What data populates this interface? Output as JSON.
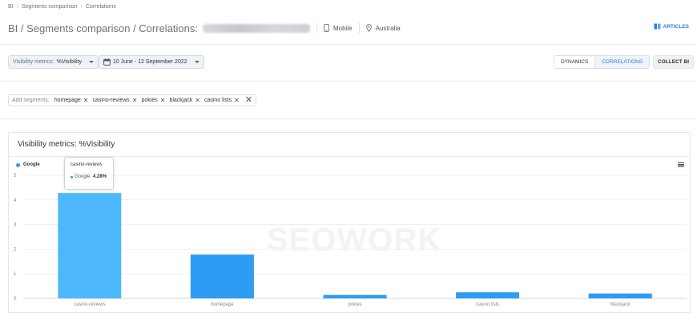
{
  "breadcrumb": [
    "BI",
    "Segments comparison",
    "Correlations"
  ],
  "title": "BI / Segments comparison / Correlations:",
  "device": "Mobile",
  "region": "Australia",
  "articles_label": "ARTICLES",
  "controls": {
    "metric_label": "Visibility metrics:",
    "metric_value": "%Visibility",
    "date_range": "10 June - 12 September 2022",
    "dynamics_label": "DYNAMICS",
    "correlations_label": "CORRELATIONS",
    "collect_label": "COLLECT BI"
  },
  "segments": {
    "label": "Add segments:",
    "items": [
      "homepage",
      "casino-reviews",
      "pokies",
      "blackjack",
      "casino lists"
    ]
  },
  "chart_card": {
    "title": "Visibility metrics: %Visibility",
    "watermark": "SEOWORK"
  },
  "tooltip": {
    "category": "casino-reviews",
    "series": "Google:",
    "value": "4.28%"
  },
  "colors": {
    "accent": "#2b7de9",
    "bar": "#2d9cf4",
    "bar_highlight": "#4db8fb"
  },
  "chart_data": {
    "type": "bar",
    "categories": [
      "casino-reviews",
      "homepage",
      "pokies",
      "casino lists",
      "blackjack"
    ],
    "series": [
      {
        "name": "Google",
        "values": [
          4.28,
          1.78,
          0.14,
          0.25,
          0.2
        ]
      }
    ],
    "ylim": [
      0,
      5
    ],
    "yticks": [
      0,
      1,
      2,
      3,
      4,
      5
    ],
    "grid": true,
    "legend": "top-left",
    "highlighted_category": "casino-reviews"
  }
}
